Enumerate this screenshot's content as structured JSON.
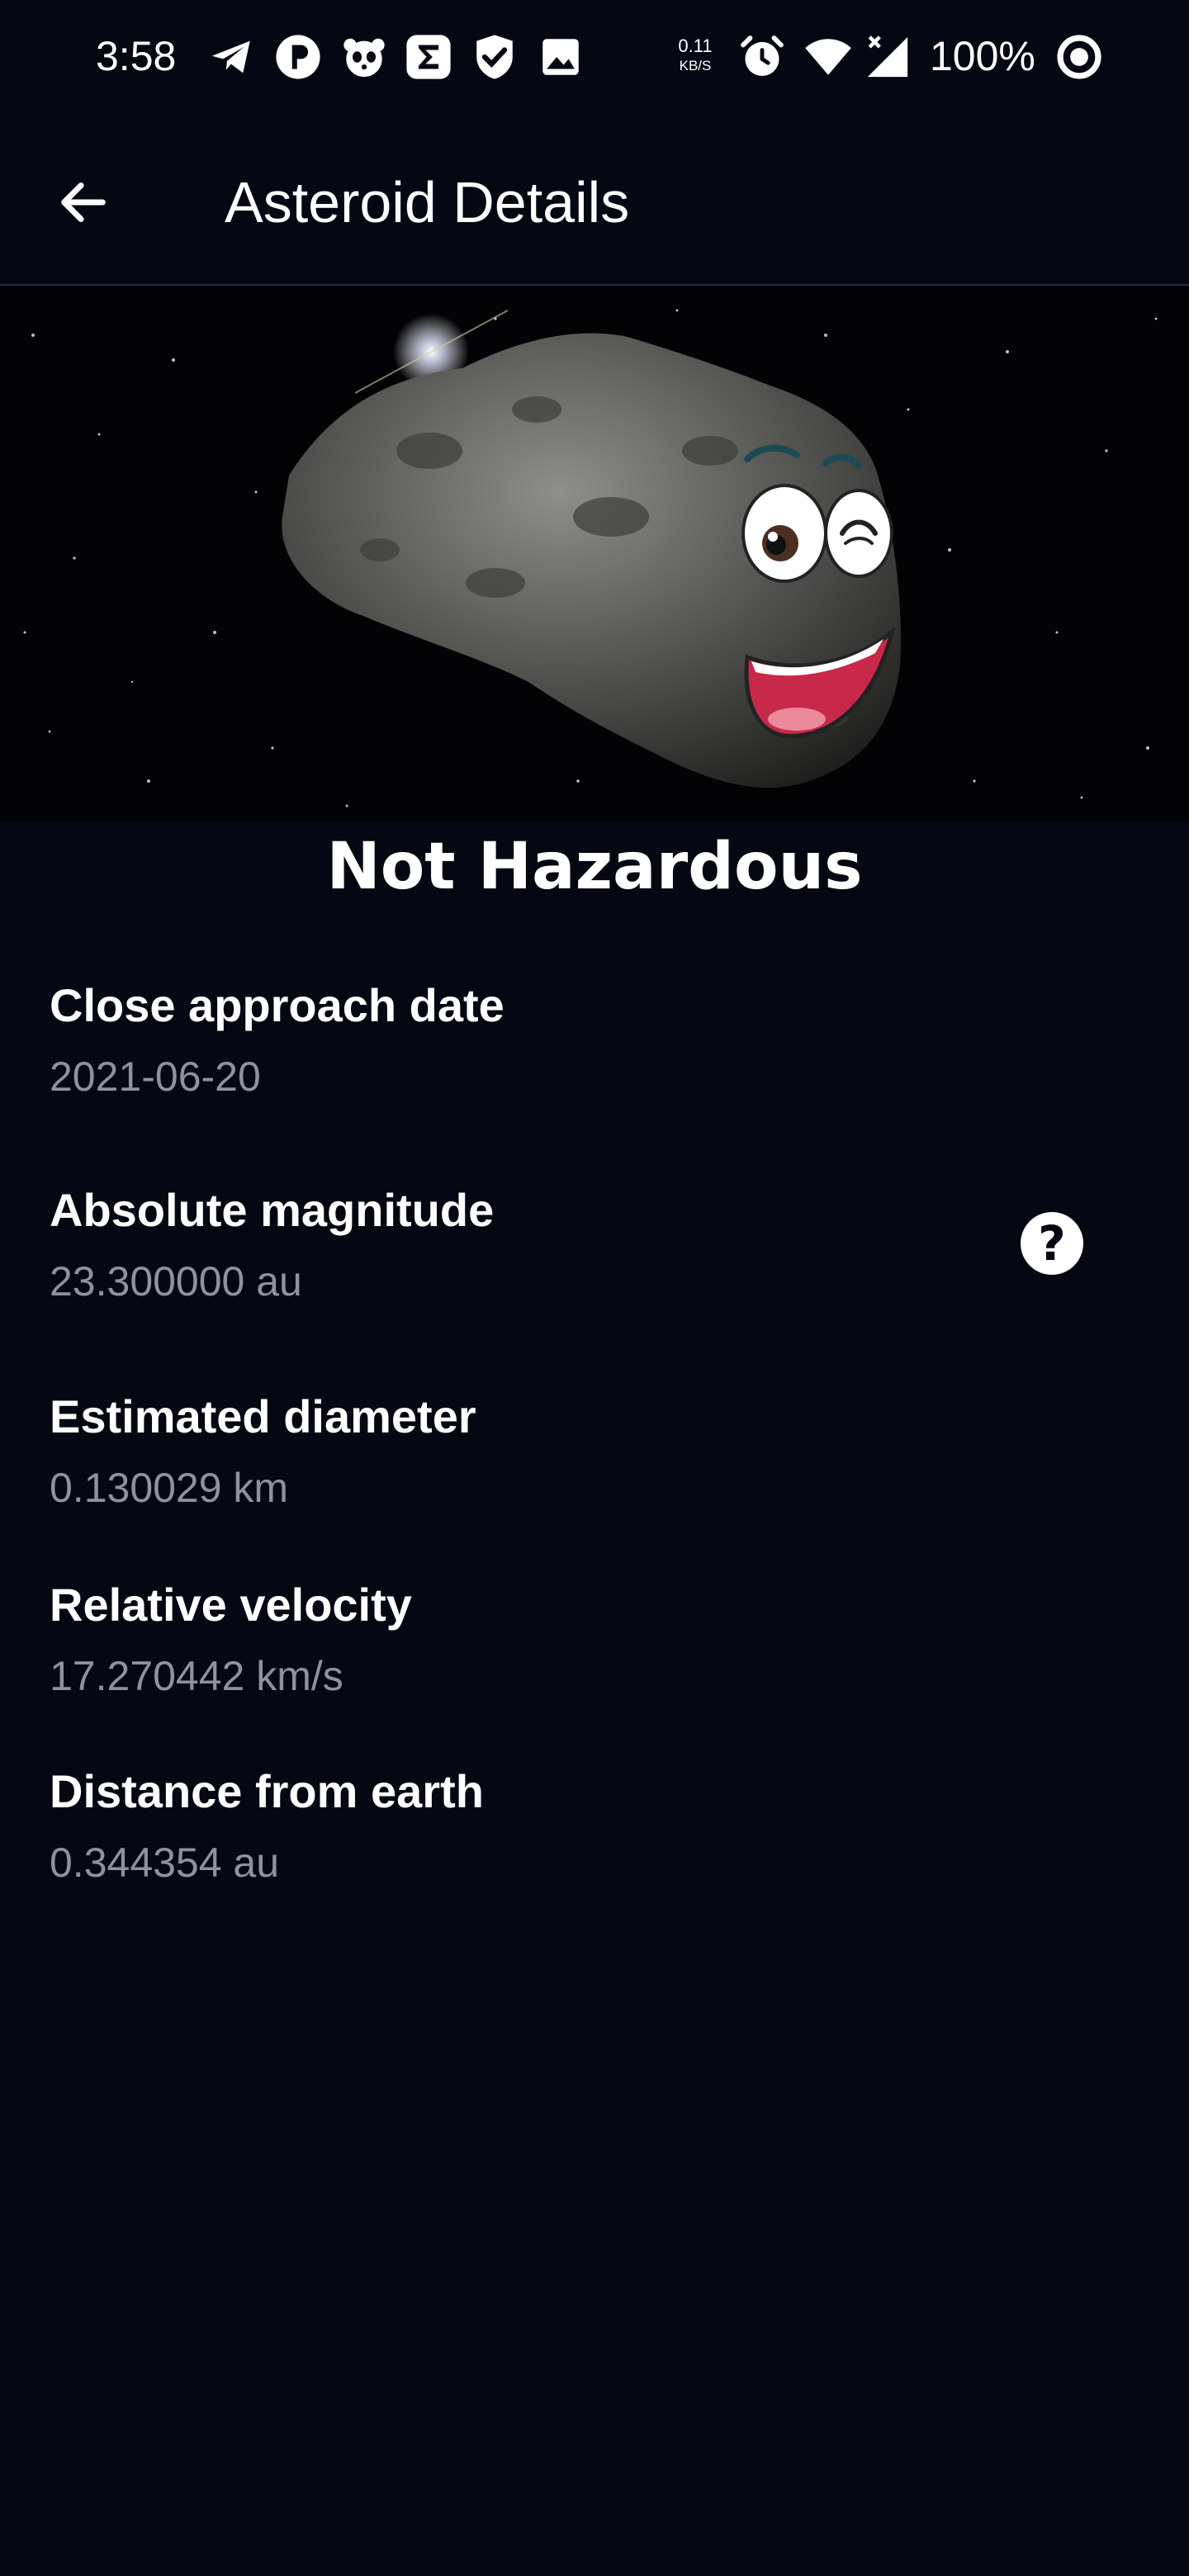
{
  "status_bar": {
    "time": "3:58",
    "network_speed_value": "0.11",
    "network_speed_unit": "KB/S",
    "battery_percent": "100%",
    "icons": [
      "telegram-icon",
      "p-app-icon",
      "panda-icon",
      "sigma-app-icon",
      "check-app-icon",
      "image-icon",
      "alarm-icon",
      "wifi-icon",
      "cell-signal-icon",
      "battery-saver-icon"
    ]
  },
  "app_bar": {
    "title": "Asteroid Details",
    "back_icon": "arrow-left-icon"
  },
  "hero": {
    "image": "cartoon-asteroid-illustration"
  },
  "hazard_status": "Not Hazardous",
  "details": [
    {
      "label": "Close approach date",
      "value": "2021-06-20"
    },
    {
      "label": "Absolute magnitude",
      "value": "23.300000 au"
    },
    {
      "label": "Estimated diameter",
      "value": "0.130029 km"
    },
    {
      "label": "Relative velocity",
      "value": "17.270442 km/s"
    },
    {
      "label": "Distance from earth",
      "value": "0.344354 au"
    }
  ],
  "help_icon": "question-mark-icon",
  "colors": {
    "background": "#050812",
    "text_primary": "#ffffff",
    "text_secondary": "#8d929c",
    "divider": "#2a2e38"
  }
}
